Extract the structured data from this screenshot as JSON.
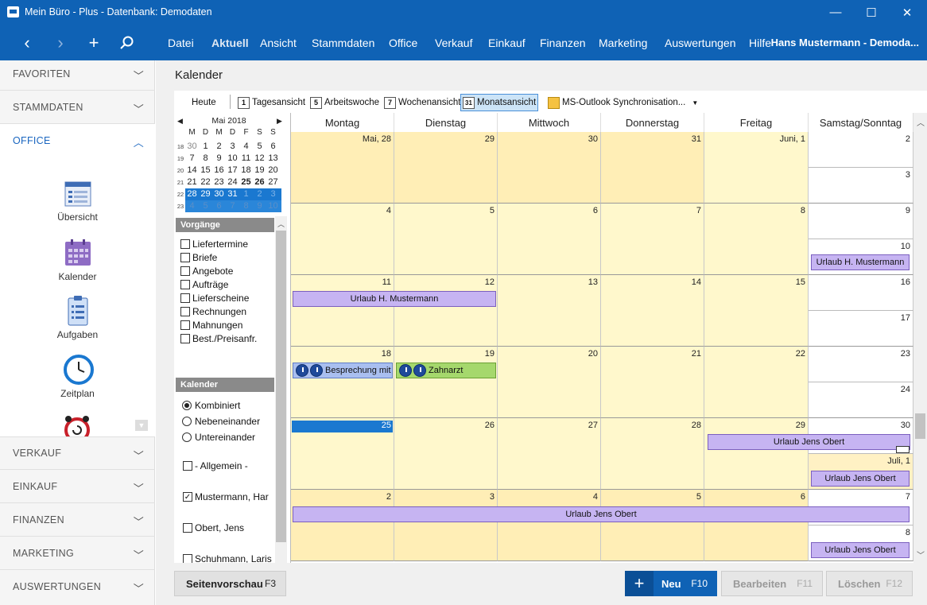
{
  "window": {
    "title": "Mein Büro - Plus - Datenbank: Demodaten"
  },
  "nav": {
    "menu": [
      "Datei",
      "Aktuell",
      "Ansicht",
      "Stammdaten",
      "Office",
      "Verkauf",
      "Einkauf",
      "Finanzen",
      "Marketing",
      "Auswertungen",
      "Hilfe"
    ],
    "user": "Hans Mustermann - Demoda..."
  },
  "sidebar": {
    "sections_top": [
      "FAVORITEN",
      "STAMMDATEN",
      "OFFICE"
    ],
    "office_items": [
      "Übersicht",
      "Kalender",
      "Aufgaben",
      "Zeitplan"
    ],
    "sections_bottom": [
      "VERKAUF",
      "EINKAUF",
      "FINANZEN",
      "MARKETING",
      "AUSWERTUNGEN"
    ]
  },
  "page": {
    "title": "Kalender"
  },
  "toolbar": {
    "today": "Heute",
    "day": "Tagesansicht",
    "day_icon": "1",
    "workweek": "Arbeitswoche",
    "workweek_icon": "5",
    "week": "Wochenansicht",
    "week_icon": "7",
    "month": "Monatsansicht",
    "month_icon": "31",
    "outlook": "MS-Outlook Synchronisation..."
  },
  "minical": {
    "title": "Mai 2018",
    "dow": [
      "M",
      "D",
      "M",
      "D",
      "F",
      "S",
      "S"
    ],
    "weeks": [
      {
        "wk": "18",
        "days": [
          "30",
          "1",
          "2",
          "3",
          "4",
          "5",
          "6"
        ]
      },
      {
        "wk": "19",
        "days": [
          "7",
          "8",
          "9",
          "10",
          "11",
          "12",
          "13"
        ]
      },
      {
        "wk": "20",
        "days": [
          "14",
          "15",
          "16",
          "17",
          "18",
          "19",
          "20"
        ]
      },
      {
        "wk": "21",
        "days": [
          "21",
          "22",
          "23",
          "24",
          "25",
          "26",
          "27"
        ]
      },
      {
        "wk": "22",
        "days": [
          "28",
          "29",
          "30",
          "31",
          "1",
          "2",
          "3"
        ]
      },
      {
        "wk": "23",
        "days": [
          "4",
          "5",
          "6",
          "7",
          "8",
          "9",
          "10"
        ]
      }
    ]
  },
  "vorgaenge": {
    "header": "Vorgänge",
    "items": [
      "Liefertermine",
      "Briefe",
      "Angebote",
      "Aufträge",
      "Lieferscheine",
      "Rechnungen",
      "Mahnungen",
      "Best./Preisanfr."
    ]
  },
  "kalender": {
    "header": "Kalender",
    "modes": [
      "Kombiniert",
      "Nebeneinander",
      "Untereinander"
    ],
    "calendars": [
      {
        "label": "- Allgemein -",
        "checked": false
      },
      {
        "label": "Mustermann, Har",
        "checked": true
      },
      {
        "label": "Obert, Jens",
        "checked": false
      },
      {
        "label": "Schuhmann, Laris",
        "checked": false
      }
    ]
  },
  "calendar": {
    "headers": [
      "Montag",
      "Dienstag",
      "Mittwoch",
      "Donnerstag",
      "Freitag",
      "Samstag/Sonntag"
    ],
    "weeks": [
      {
        "days": [
          "Mai, 28",
          "29",
          "30",
          "31",
          "Juni, 1"
        ],
        "sat": "2",
        "sun": "3"
      },
      {
        "days": [
          "4",
          "5",
          "6",
          "7",
          "8"
        ],
        "sat": "9",
        "sun": "10"
      },
      {
        "days": [
          "11",
          "12",
          "13",
          "14",
          "15"
        ],
        "sat": "16",
        "sun": "17"
      },
      {
        "days": [
          "18",
          "19",
          "20",
          "21",
          "22"
        ],
        "sat": "23",
        "sun": "24"
      },
      {
        "days": [
          "25",
          "26",
          "27",
          "28",
          "29"
        ],
        "sat": "30",
        "sun": "Juli, 1"
      },
      {
        "days": [
          "2",
          "3",
          "4",
          "5",
          "6"
        ],
        "sat": "7",
        "sun": "8"
      }
    ],
    "events": {
      "urlaub_hm_sun10": "Urlaub H. Mustermann",
      "urlaub_hm_wk3": "Urlaub H. Mustermann",
      "besprechung": "Besprechung mit",
      "zahnarzt": "Zahnarzt",
      "urlaub_jo_fri": "Urlaub Jens Obert",
      "urlaub_jo_jul1": "Urlaub Jens Obert",
      "urlaub_jo_wk6": "Urlaub Jens Obert",
      "urlaub_jo_sun8": "Urlaub Jens Obert"
    }
  },
  "bottom": {
    "preview": "Seitenvorschau",
    "preview_key": "F3",
    "new": "Neu",
    "new_key": "F10",
    "edit": "Bearbeiten",
    "edit_key": "F11",
    "delete": "Löschen",
    "delete_key": "F12"
  },
  "colors": {
    "accent": "#0f62b5",
    "event_purple": "#c6b4f2",
    "event_green": "#a5d86c",
    "cell": "#fff8cc",
    "today": "#1a78d0"
  }
}
